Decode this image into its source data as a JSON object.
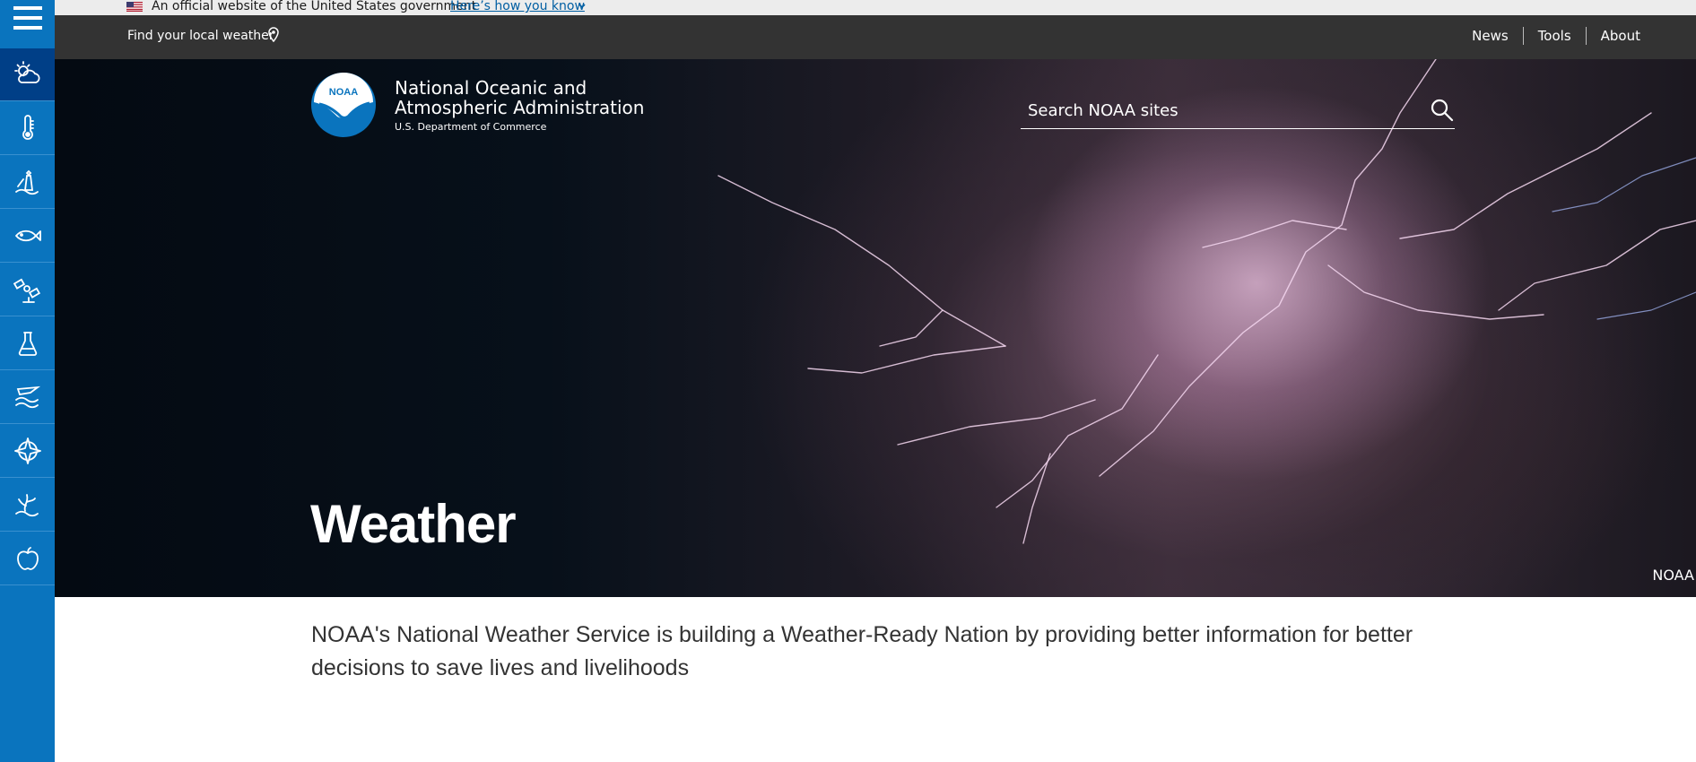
{
  "gov_banner": {
    "text": "An official website of the United States government",
    "link": "Here’s how you know"
  },
  "topnav": {
    "find_local": "Find your local weather",
    "links": [
      "News",
      "Tools",
      "About"
    ]
  },
  "sidebar": {
    "items": [
      {
        "icon": "weather-icon",
        "active": true
      },
      {
        "icon": "climate-thermometer-icon",
        "active": false
      },
      {
        "icon": "ocean-coasts-icon",
        "active": false
      },
      {
        "icon": "fisheries-fish-icon",
        "active": false
      },
      {
        "icon": "satellites-icon",
        "active": false
      },
      {
        "icon": "research-flask-icon",
        "active": false
      },
      {
        "icon": "marine-aviation-icon",
        "active": false
      },
      {
        "icon": "charting-compass-icon",
        "active": false
      },
      {
        "icon": "sanctuaries-icon",
        "active": false
      },
      {
        "icon": "education-apple-icon",
        "active": false
      }
    ]
  },
  "header": {
    "logo_text": "NOAA",
    "agency_line1": "National Oceanic and",
    "agency_line2": "Atmospheric Administration",
    "department": "U.S. Department of Commerce"
  },
  "search": {
    "placeholder": "Search NOAA sites"
  },
  "hero": {
    "title": "Weather",
    "credit": "NOAA"
  },
  "intro": {
    "text": "NOAA's National Weather Service is building a Weather-Ready Nation by providing better information for better decisions to save lives and livelihoods"
  },
  "colors": {
    "sidebar": "#0a74be",
    "sidebar_active": "#003f87",
    "topnav": "#333333",
    "gov_banner": "#ececec",
    "link": "#005ea2"
  }
}
